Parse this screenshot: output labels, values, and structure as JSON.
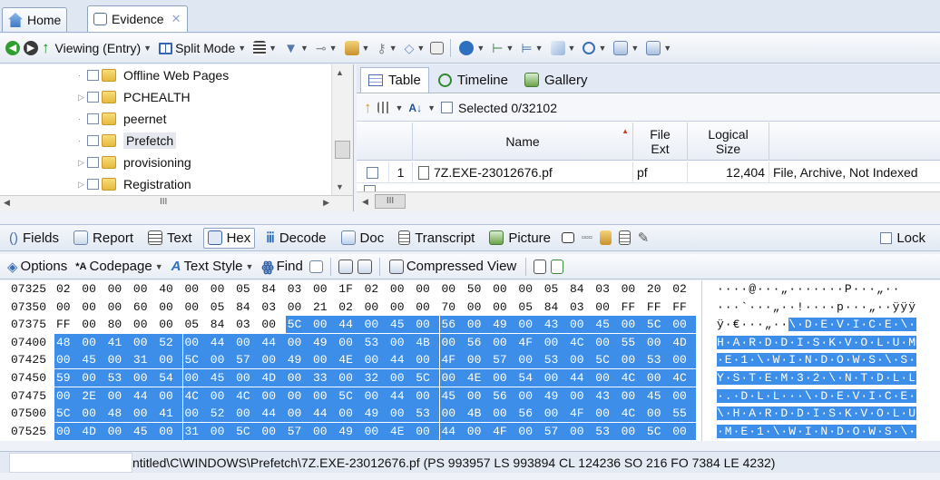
{
  "tabs": [
    {
      "label": "Home",
      "icon": "home-icon",
      "active": false
    },
    {
      "label": "Evidence",
      "icon": "evidence-icon",
      "active": true
    }
  ],
  "toolbar": {
    "viewing": "Viewing (Entry)",
    "split_mode": "Split Mode"
  },
  "tree": {
    "items": [
      {
        "label": "Offline Web Pages",
        "expandable": false
      },
      {
        "label": "PCHEALTH",
        "expandable": true
      },
      {
        "label": "peernet",
        "expandable": false
      },
      {
        "label": "Prefetch",
        "expandable": false,
        "selected": true
      },
      {
        "label": "provisioning",
        "expandable": true
      },
      {
        "label": "Registration",
        "expandable": true
      }
    ],
    "hscroll_label": "III"
  },
  "results": {
    "subtabs": [
      {
        "label": "Table",
        "active": true
      },
      {
        "label": "Timeline",
        "active": false
      },
      {
        "label": "Gallery",
        "active": false
      }
    ],
    "selected_label": "Selected 0/32102",
    "columns": {
      "name": "Name",
      "ext": "File Ext",
      "size": "Logical Size"
    },
    "row": {
      "num": "1",
      "name": "7Z.EXE-23012676.pf",
      "ext": "pf",
      "size": "12,404",
      "desc": "File, Archive, Not Indexed"
    },
    "hscroll_label": "III"
  },
  "viewtabs": [
    {
      "label": "Fields",
      "active": false
    },
    {
      "label": "Report",
      "active": false
    },
    {
      "label": "Text",
      "active": false
    },
    {
      "label": "Hex",
      "active": true
    },
    {
      "label": "Decode",
      "active": false
    },
    {
      "label": "Doc",
      "active": false
    },
    {
      "label": "Transcript",
      "active": false
    },
    {
      "label": "Picture",
      "active": false
    }
  ],
  "lock_label": "Lock",
  "hextools": {
    "options": "Options",
    "codepage": "Codepage",
    "text_style": "Text Style",
    "find": "Find",
    "compressed_view": "Compressed View"
  },
  "hex": {
    "rows": [
      {
        "offset": "07325",
        "bytes": [
          "02",
          "00",
          "00",
          "00",
          "40",
          "00",
          "00",
          "05",
          "84",
          "03",
          "00",
          "1F",
          "02",
          "00",
          "00",
          "00",
          "50",
          "00",
          "00",
          "05",
          "84",
          "03",
          "00",
          "20",
          "02"
        ],
        "hl_start": 99,
        "ascii": "····@···„·······P···„··"
      },
      {
        "offset": "07350",
        "bytes": [
          "00",
          "00",
          "00",
          "60",
          "00",
          "00",
          "05",
          "84",
          "03",
          "00",
          "21",
          "02",
          "00",
          "00",
          "00",
          "70",
          "00",
          "00",
          "05",
          "84",
          "03",
          "00",
          "FF",
          "FF",
          "FF"
        ],
        "hl_start": 99,
        "ascii": "···`···„··!····p···„··ÿÿÿ"
      },
      {
        "offset": "07375",
        "bytes": [
          "FF",
          "00",
          "80",
          "00",
          "00",
          "05",
          "84",
          "03",
          "00",
          "5C",
          "00",
          "44",
          "00",
          "45",
          "00",
          "56",
          "00",
          "49",
          "00",
          "43",
          "00",
          "45",
          "00",
          "5C",
          "00"
        ],
        "hl_start": 9,
        "ascii": "ÿ·€···„··\\·D·E·V·I·C·E·\\·"
      },
      {
        "offset": "07400",
        "bytes": [
          "48",
          "00",
          "41",
          "00",
          "52",
          "00",
          "44",
          "00",
          "44",
          "00",
          "49",
          "00",
          "53",
          "00",
          "4B",
          "00",
          "56",
          "00",
          "4F",
          "00",
          "4C",
          "00",
          "55",
          "00",
          "4D"
        ],
        "hl_start": 0,
        "ascii": "H·A·R·D·D·I·S·K·V·O·L·U·M"
      },
      {
        "offset": "07425",
        "bytes": [
          "00",
          "45",
          "00",
          "31",
          "00",
          "5C",
          "00",
          "57",
          "00",
          "49",
          "00",
          "4E",
          "00",
          "44",
          "00",
          "4F",
          "00",
          "57",
          "00",
          "53",
          "00",
          "5C",
          "00",
          "53",
          "00"
        ],
        "hl_start": 0,
        "ascii": "·E·1·\\·W·I·N·D·O·W·S·\\·S·"
      },
      {
        "offset": "07450",
        "bytes": [
          "59",
          "00",
          "53",
          "00",
          "54",
          "00",
          "45",
          "00",
          "4D",
          "00",
          "33",
          "00",
          "32",
          "00",
          "5C",
          "00",
          "4E",
          "00",
          "54",
          "00",
          "44",
          "00",
          "4C",
          "00",
          "4C"
        ],
        "hl_start": 0,
        "ascii": "Y·S·T·E·M·3·2·\\·N·T·D·L·L"
      },
      {
        "offset": "07475",
        "bytes": [
          "00",
          "2E",
          "00",
          "44",
          "00",
          "4C",
          "00",
          "4C",
          "00",
          "00",
          "00",
          "5C",
          "00",
          "44",
          "00",
          "45",
          "00",
          "56",
          "00",
          "49",
          "00",
          "43",
          "00",
          "45",
          "00"
        ],
        "hl_start": 0,
        "ascii": "·.·D·L·L···\\·D·E·V·I·C·E·"
      },
      {
        "offset": "07500",
        "bytes": [
          "5C",
          "00",
          "48",
          "00",
          "41",
          "00",
          "52",
          "00",
          "44",
          "00",
          "44",
          "00",
          "49",
          "00",
          "53",
          "00",
          "4B",
          "00",
          "56",
          "00",
          "4F",
          "00",
          "4C",
          "00",
          "55"
        ],
        "hl_start": 0,
        "ascii": "\\·H·A·R·D·D·I·S·K·V·O·L·U"
      },
      {
        "offset": "07525",
        "bytes": [
          "00",
          "4D",
          "00",
          "45",
          "00",
          "31",
          "00",
          "5C",
          "00",
          "57",
          "00",
          "49",
          "00",
          "4E",
          "00",
          "44",
          "00",
          "4F",
          "00",
          "57",
          "00",
          "53",
          "00",
          "5C",
          "00"
        ],
        "hl_start": 0,
        "ascii": "·M·E·1·\\·W·I·N·D·O·W·S·\\·"
      }
    ]
  },
  "status": "ntitled\\C\\WINDOWS\\Prefetch\\7Z.EXE-23012676.pf (PS 993957 LS 993894 CL 124236 SO 216 FO 7384 LE 4232)",
  "colors": {
    "highlight": "#3d8ee8",
    "chrome": "#e2e9f3",
    "folder": "#e8b93c"
  }
}
